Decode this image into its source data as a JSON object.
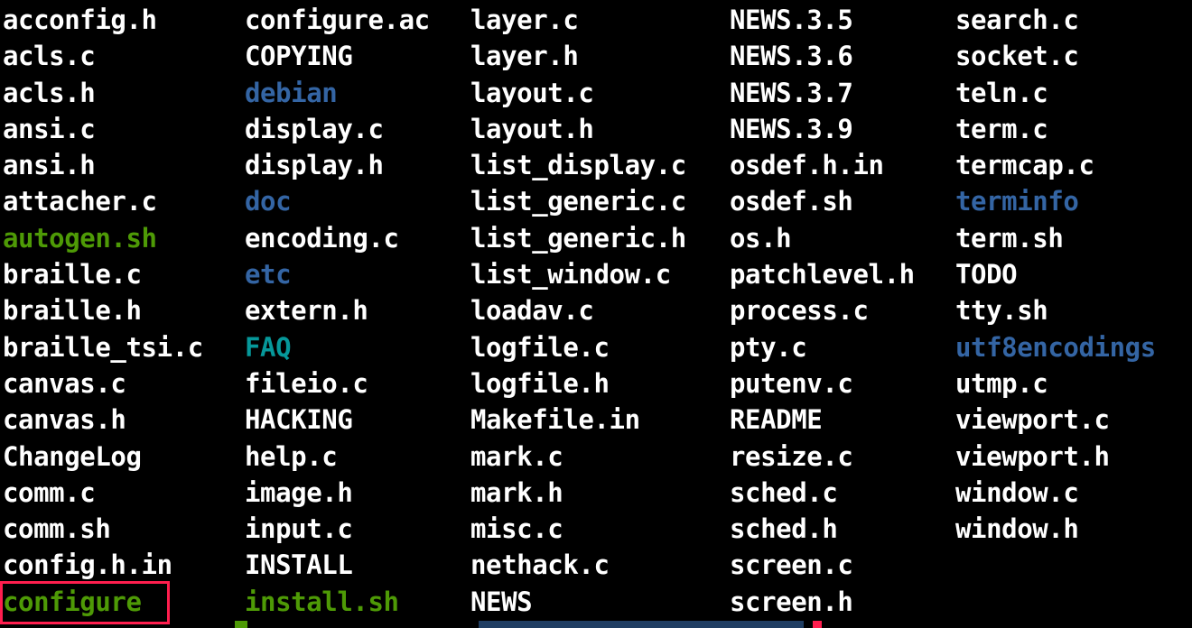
{
  "colors": {
    "background": "#000000",
    "file": "#ffffff",
    "directory": "#3465a4",
    "executable": "#4e9a06",
    "symlink": "#06989a",
    "highlight": "#ff1e4e"
  },
  "listing": {
    "columns": [
      [
        {
          "name": "acconfig.h",
          "type": "file"
        },
        {
          "name": "acls.c",
          "type": "file"
        },
        {
          "name": "acls.h",
          "type": "file"
        },
        {
          "name": "ansi.c",
          "type": "file"
        },
        {
          "name": "ansi.h",
          "type": "file"
        },
        {
          "name": "attacher.c",
          "type": "file"
        },
        {
          "name": "autogen.sh",
          "type": "exec"
        },
        {
          "name": "braille.c",
          "type": "file"
        },
        {
          "name": "braille.h",
          "type": "file"
        },
        {
          "name": "braille_tsi.c",
          "type": "file"
        },
        {
          "name": "canvas.c",
          "type": "file"
        },
        {
          "name": "canvas.h",
          "type": "file"
        },
        {
          "name": "ChangeLog",
          "type": "file"
        },
        {
          "name": "comm.c",
          "type": "file"
        },
        {
          "name": "comm.sh",
          "type": "file"
        },
        {
          "name": "config.h.in",
          "type": "file"
        },
        {
          "name": "configure",
          "type": "exec"
        }
      ],
      [
        {
          "name": "configure.ac",
          "type": "file"
        },
        {
          "name": "COPYING",
          "type": "file"
        },
        {
          "name": "debian",
          "type": "dir"
        },
        {
          "name": "display.c",
          "type": "file"
        },
        {
          "name": "display.h",
          "type": "file"
        },
        {
          "name": "doc",
          "type": "dir"
        },
        {
          "name": "encoding.c",
          "type": "file"
        },
        {
          "name": "etc",
          "type": "dir"
        },
        {
          "name": "extern.h",
          "type": "file"
        },
        {
          "name": "FAQ",
          "type": "link"
        },
        {
          "name": "fileio.c",
          "type": "file"
        },
        {
          "name": "HACKING",
          "type": "file"
        },
        {
          "name": "help.c",
          "type": "file"
        },
        {
          "name": "image.h",
          "type": "file"
        },
        {
          "name": "input.c",
          "type": "file"
        },
        {
          "name": "INSTALL",
          "type": "file"
        },
        {
          "name": "install.sh",
          "type": "exec"
        }
      ],
      [
        {
          "name": "layer.c",
          "type": "file"
        },
        {
          "name": "layer.h",
          "type": "file"
        },
        {
          "name": "layout.c",
          "type": "file"
        },
        {
          "name": "layout.h",
          "type": "file"
        },
        {
          "name": "list_display.c",
          "type": "file"
        },
        {
          "name": "list_generic.c",
          "type": "file"
        },
        {
          "name": "list_generic.h",
          "type": "file"
        },
        {
          "name": "list_window.c",
          "type": "file"
        },
        {
          "name": "loadav.c",
          "type": "file"
        },
        {
          "name": "logfile.c",
          "type": "file"
        },
        {
          "name": "logfile.h",
          "type": "file"
        },
        {
          "name": "Makefile.in",
          "type": "file"
        },
        {
          "name": "mark.c",
          "type": "file"
        },
        {
          "name": "mark.h",
          "type": "file"
        },
        {
          "name": "misc.c",
          "type": "file"
        },
        {
          "name": "nethack.c",
          "type": "file"
        },
        {
          "name": "NEWS",
          "type": "file"
        }
      ],
      [
        {
          "name": "NEWS.3.5",
          "type": "file"
        },
        {
          "name": "NEWS.3.6",
          "type": "file"
        },
        {
          "name": "NEWS.3.7",
          "type": "file"
        },
        {
          "name": "NEWS.3.9",
          "type": "file"
        },
        {
          "name": "osdef.h.in",
          "type": "file"
        },
        {
          "name": "osdef.sh",
          "type": "file"
        },
        {
          "name": "os.h",
          "type": "file"
        },
        {
          "name": "patchlevel.h",
          "type": "file"
        },
        {
          "name": "process.c",
          "type": "file"
        },
        {
          "name": "pty.c",
          "type": "file"
        },
        {
          "name": "putenv.c",
          "type": "file"
        },
        {
          "name": "README",
          "type": "file"
        },
        {
          "name": "resize.c",
          "type": "file"
        },
        {
          "name": "sched.c",
          "type": "file"
        },
        {
          "name": "sched.h",
          "type": "file"
        },
        {
          "name": "screen.c",
          "type": "file"
        },
        {
          "name": "screen.h",
          "type": "file"
        }
      ],
      [
        {
          "name": "search.c",
          "type": "file"
        },
        {
          "name": "socket.c",
          "type": "file"
        },
        {
          "name": "teln.c",
          "type": "file"
        },
        {
          "name": "term.c",
          "type": "file"
        },
        {
          "name": "termcap.c",
          "type": "file"
        },
        {
          "name": "terminfo",
          "type": "dir"
        },
        {
          "name": "term.sh",
          "type": "file"
        },
        {
          "name": "TODO",
          "type": "file"
        },
        {
          "name": "tty.sh",
          "type": "file"
        },
        {
          "name": "utf8encodings",
          "type": "dir"
        },
        {
          "name": "utmp.c",
          "type": "file"
        },
        {
          "name": "viewport.c",
          "type": "file"
        },
        {
          "name": "viewport.h",
          "type": "file"
        },
        {
          "name": "window.c",
          "type": "file"
        },
        {
          "name": "window.h",
          "type": "file"
        }
      ]
    ]
  }
}
